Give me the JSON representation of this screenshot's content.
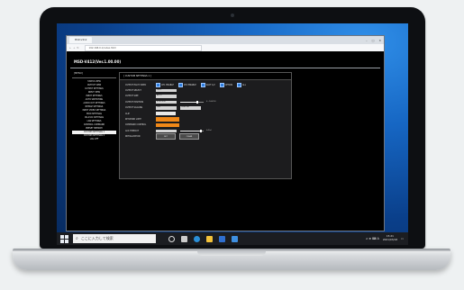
{
  "browser": {
    "tab_label": "MSD-V412",
    "url": "192.168.0.1/index.html",
    "window_controls": [
      "–",
      "□",
      "✕"
    ]
  },
  "page": {
    "model_title": "MSD-V412(Ver.1.00.00)",
    "menu_header": "[MENU]",
    "menu_items": [
      "STATUS VIEW",
      "OUTPUT VIEW",
      "OUTPUT SETTINGS",
      "INPUT VIEW",
      "INPUT SETTINGS",
      "AUTO SWITCHING",
      "AUDIO OUT SETTINGS",
      "BITMAP SETTINGS",
      "INPUT VIDEO SETTINGS",
      "EDID SETTINGS",
      "RS-232C SETTINGS",
      "LAN SETTINGS",
      "CONTROL COMMAND",
      "PRESET MEMORY",
      "CUSTOM SETTINGS 1",
      "CUSTOM SETTINGS 2",
      "LOG OFF"
    ],
    "active_menu_index": 14,
    "content_title": "[ CUSTOM SETTINGS 1 ]",
    "rows": [
      {
        "label": "OUTPUT EACH VIDEO",
        "type": "checks",
        "checks": [
          "CH1 ENABLE",
          "CH2 ENABLE",
          "SLOT 1/2",
          "OPTION",
          "ALL"
        ]
      },
      {
        "label": "OUTPUT SELECT",
        "type": "select",
        "value": "OUT1"
      },
      {
        "label": "OUTPUT SIZE",
        "type": "select",
        "value": "AUTO"
      },
      {
        "label": "OUTPUT POSITION",
        "type": "slider",
        "value": "POSITION",
        "unit": "0 : 100(%)",
        "level": 0.72
      },
      {
        "label": "OUTPUT SCALING",
        "type": "select2",
        "value": "OFF",
        "value2": "CUSTOM"
      },
      {
        "label": "CLIP",
        "type": "white"
      },
      {
        "label": "KEYWORD LIMIT",
        "type": "orange"
      },
      {
        "label": "COMMAND CONTROL",
        "type": "orange"
      },
      {
        "label": "ACK TIMEOUT",
        "type": "slider",
        "value": "",
        "unit": "0-9(s)",
        "level": 0.9
      },
      {
        "label": "INITIALIZATION",
        "type": "buttons",
        "buttons": [
          "SET",
          "CLEAR"
        ]
      }
    ]
  },
  "taskbar": {
    "search_placeholder": "ここに入力して検索",
    "tray_text": "∧ ⊕ ⌨ A",
    "time": "15:21",
    "date": "2021/03/18"
  },
  "colors": {
    "accent_orange": "#f08818",
    "check_blue": "#2f7fe0"
  }
}
